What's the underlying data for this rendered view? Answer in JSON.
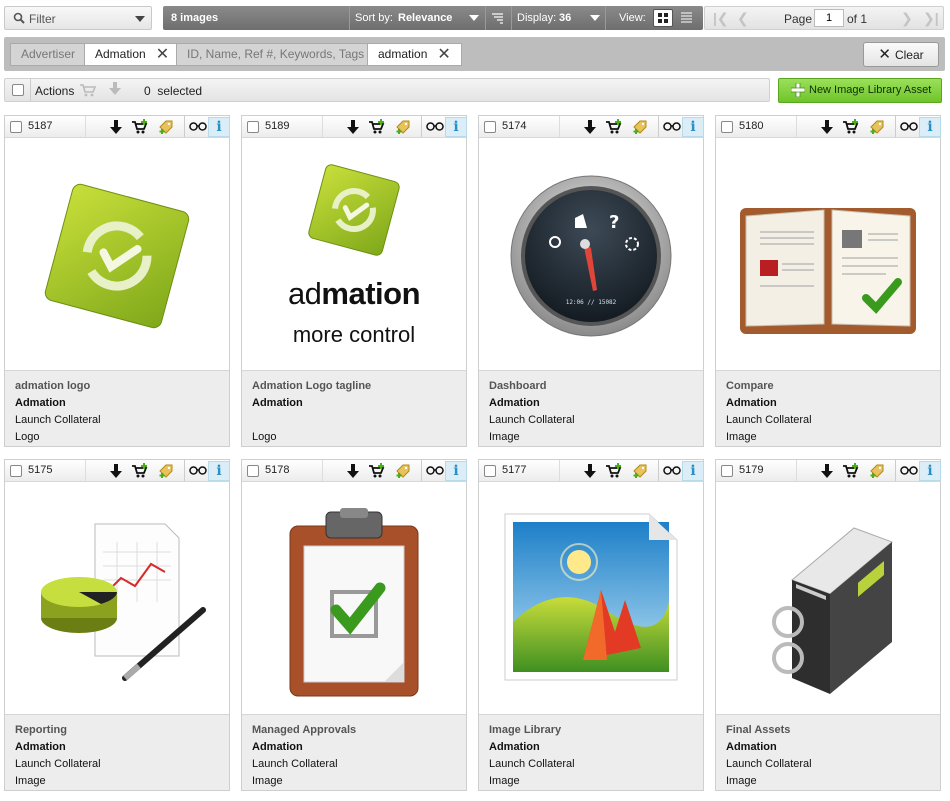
{
  "toolbar": {
    "filter_label": "Filter",
    "count_label": "8 images",
    "sort_prefix": "Sort by:",
    "sort_value": "Relevance",
    "display_prefix": "Display:",
    "display_value": "36",
    "view_label": "View:",
    "page_label": "Page",
    "page_value": "1",
    "of_label": "of 1"
  },
  "filters": {
    "advertiser_key": "Advertiser",
    "advertiser_value": "Admation",
    "search_key": "ID, Name, Ref #, Keywords, Tags",
    "search_value": "admation",
    "clear_label": "Clear"
  },
  "actions": {
    "label": "Actions",
    "selected_count": "0",
    "selected_label": "selected",
    "new_button_label": "New Image Library Asset"
  },
  "colors": {
    "accent_green": "#7ccf3a",
    "info_blue": "#2a8fc4",
    "dark_toolbar": "#7b7b7b"
  },
  "cards": [
    {
      "id": "5187",
      "title": "admation logo",
      "advertiser": "Admation",
      "campaign": "Launch Collateral",
      "type": "Logo",
      "icon": "admation-logo-icon"
    },
    {
      "id": "5189",
      "title": "Admation Logo tagline",
      "advertiser": "Admation",
      "campaign": "",
      "type": "Logo",
      "icon": "admation-logo-tagline-icon",
      "logo_text_a": "ad",
      "logo_text_b": "mation",
      "tagline": "more control"
    },
    {
      "id": "5174",
      "title": "Dashboard",
      "advertiser": "Admation",
      "campaign": "Launch Collateral",
      "type": "Image",
      "icon": "dashboard-gauge-icon",
      "gauge_text": "12:06 // 15082"
    },
    {
      "id": "5180",
      "title": "Compare",
      "advertiser": "Admation",
      "campaign": "Launch Collateral",
      "type": "Image",
      "icon": "compare-book-icon"
    },
    {
      "id": "5175",
      "title": "Reporting",
      "advertiser": "Admation",
      "campaign": "Launch Collateral",
      "type": "Image",
      "icon": "reporting-chart-icon"
    },
    {
      "id": "5178",
      "title": "Managed Approvals",
      "advertiser": "Admation",
      "campaign": "Launch Collateral",
      "type": "Image",
      "icon": "clipboard-approval-icon"
    },
    {
      "id": "5177",
      "title": "Image Library",
      "advertiser": "Admation",
      "campaign": "Launch Collateral",
      "type": "Image",
      "icon": "image-library-icon"
    },
    {
      "id": "5179",
      "title": "Final Assets",
      "advertiser": "Admation",
      "campaign": "Launch Collateral",
      "type": "Image",
      "icon": "final-assets-binder-icon"
    }
  ]
}
